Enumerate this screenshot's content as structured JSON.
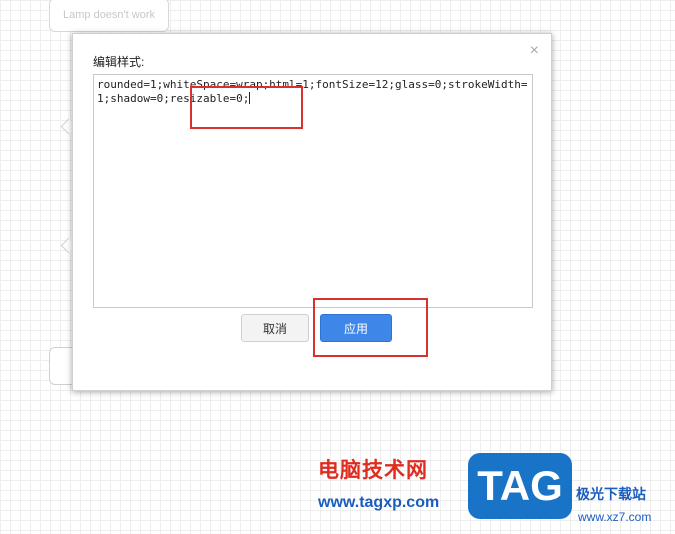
{
  "canvas": {
    "top_shape_label": "Lamp doesn't work"
  },
  "dialog": {
    "title": "编辑样式:",
    "close_glyph": "×",
    "style_text": "rounded=1;whiteSpace=wrap;html=1;fontSize=12;glass=0;strokeWidth=1;shadow=0;resizable=0;",
    "cancel_label": "取消",
    "apply_label": "应用"
  },
  "watermark": {
    "site_cn": "电脑技术网",
    "site_url": "www.tagxp.com",
    "logo_text": "TAG",
    "site_cn_2": "极光下载站",
    "site_url_2": "www.xz7.com"
  },
  "colors": {
    "highlight": "#d9312b",
    "apply_button": "#3e87e8"
  }
}
